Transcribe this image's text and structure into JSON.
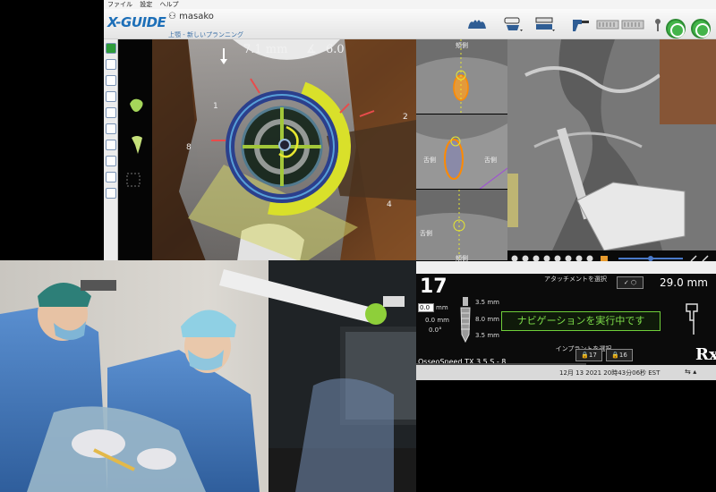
{
  "menu": [
    "ファイル",
    "設定",
    "ヘルプ"
  ],
  "app": {
    "logo": "X-GUIDE",
    "patient": "masako",
    "plan": "上顎 - 新しいプランニング"
  },
  "navigation": {
    "depth_readout": "7.1 mm",
    "angle_readout": "6.0",
    "directions": [
      "1",
      "2",
      "8",
      "4"
    ]
  },
  "ct_slices": {
    "labels": [
      "頬側",
      "舌側",
      "舌側",
      "舌側",
      "頬側"
    ]
  },
  "instrument": {
    "tooth_number": "17",
    "attachment_label": "アタッチメントを選択",
    "drill_depth": "29.0 mm",
    "offset_input": "0.0",
    "offset_unit": "mm",
    "values_left": [
      "0.0 mm",
      "0.0°"
    ],
    "values_right": [
      "3.5 mm",
      "8.0 mm",
      "3.5 mm"
    ],
    "nav_status": "ナビゲーションを実行中です",
    "implant_label": "インプラントを選択",
    "implant_name": "OsseoSpeed TX 3.5 S - 8 ...",
    "implant_buttons": [
      "17",
      "16"
    ],
    "rx": "Rx"
  },
  "status": {
    "datetime": "12月 13 2021 20時43分06秒 EST"
  },
  "colors": {
    "accent_green": "#6fcf3a",
    "brand_blue": "#1d6fb8",
    "ring_yellow": "#d9e02a"
  }
}
